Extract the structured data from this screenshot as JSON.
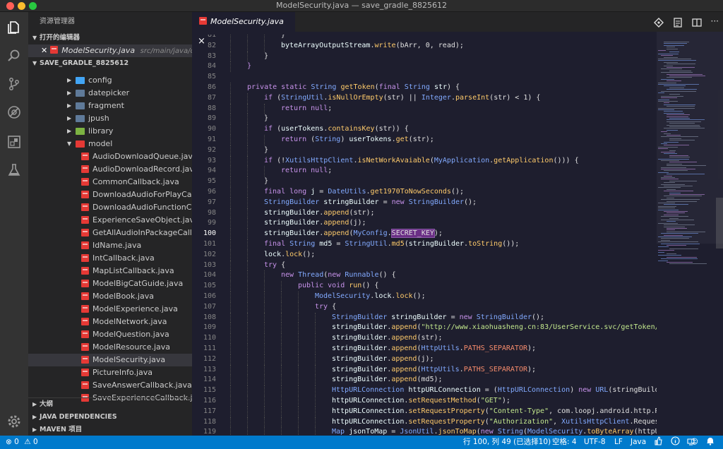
{
  "window": {
    "title": "ModelSecurity.java — save_gradle_8825612",
    "traffic": {
      "close": "#ff5f57",
      "minimize": "#febc2e",
      "zoom": "#28c840"
    }
  },
  "activity_bar": [
    "files-icon",
    "search-icon",
    "source-control-icon",
    "debug-icon",
    "extensions-icon",
    "test-icon",
    "settings-gear-icon"
  ],
  "sidebar": {
    "header": "资源管理器",
    "open_editors": {
      "title": "打开的编辑器",
      "items": [
        {
          "name": "ModelSecurity.java",
          "path": "src/main/java/co..."
        }
      ]
    },
    "project": {
      "title": "SAVE_GRADLE_8825612",
      "folders": [
        {
          "label": "config",
          "color": "#42a5f5"
        },
        {
          "label": "datepicker",
          "color": "#5f7a99"
        },
        {
          "label": "fragment",
          "color": "#5f7a99"
        },
        {
          "label": "jpush",
          "color": "#5f7a99"
        },
        {
          "label": "library",
          "color": "#7cb342"
        },
        {
          "label": "model",
          "color": "#e53935"
        }
      ],
      "files": [
        "AudioDownloadQueue.java",
        "AudioDownloadRecord.java",
        "CommonCallback.java",
        "DownloadAudioForPlayCal...",
        "DownloadAudioFunctionC...",
        "ExperienceSaveObject.java",
        "GetAllAudioInPackageCall...",
        "IdName.java",
        "IntCallback.java",
        "MapListCallback.java",
        "ModelBigCatGuide.java",
        "ModelBook.java",
        "ModelExperience.java",
        "ModelNetwork.java",
        "ModelQuestion.java",
        "ModelResource.java",
        "ModelSecurity.java",
        "PictureInfo.java",
        "SaveAnswerCallback.java",
        "SaveExperienceCallback.j..."
      ],
      "selected_file": "ModelSecurity.java"
    },
    "bottom_sections": [
      "大纲",
      "JAVA DEPENDENCIES",
      "MAVEN 项目"
    ]
  },
  "editor": {
    "tab": {
      "label": "ModelSecurity.java",
      "close": "×"
    },
    "current_line": 100,
    "lines": [
      {
        "n": "81",
        "indent": 3,
        "tokens": [
          [
            "}",
            "p"
          ]
        ]
      },
      {
        "n": "82",
        "indent": 3,
        "tokens": [
          [
            "byteArrayOutputStream",
            "v"
          ],
          [
            ".",
            "p"
          ],
          [
            "write",
            "f"
          ],
          [
            "(bArr, 0, read);",
            "p"
          ]
        ]
      },
      {
        "n": "83",
        "indent": 2,
        "tokens": [
          [
            "}",
            "p"
          ]
        ]
      },
      {
        "n": "84",
        "indent": 1,
        "tokens": [
          [
            "}",
            "k"
          ]
        ]
      },
      {
        "n": "85",
        "indent": 0,
        "tokens": []
      },
      {
        "n": "86",
        "indent": 1,
        "tokens": [
          [
            "private static ",
            "k"
          ],
          [
            "String ",
            "t"
          ],
          [
            "getToken",
            "f"
          ],
          [
            "(",
            "p"
          ],
          [
            "final ",
            "k"
          ],
          [
            "String ",
            "t"
          ],
          [
            "str",
            "v"
          ],
          [
            ") {",
            "p"
          ]
        ]
      },
      {
        "n": "87",
        "indent": 2,
        "tokens": [
          [
            "if ",
            "k"
          ],
          [
            "(",
            "p"
          ],
          [
            "StringUtil",
            "t"
          ],
          [
            ".",
            "p"
          ],
          [
            "isNullOrEmpty",
            "f"
          ],
          [
            "(str) || ",
            "p"
          ],
          [
            "Integer",
            "t"
          ],
          [
            ".",
            "p"
          ],
          [
            "parseInt",
            "f"
          ],
          [
            "(str) < 1) {",
            "p"
          ]
        ]
      },
      {
        "n": "88",
        "indent": 3,
        "tokens": [
          [
            "return null",
            "k"
          ],
          [
            ";",
            "p"
          ]
        ]
      },
      {
        "n": "89",
        "indent": 2,
        "tokens": [
          [
            "}",
            "p"
          ]
        ]
      },
      {
        "n": "90",
        "indent": 2,
        "tokens": [
          [
            "if ",
            "k"
          ],
          [
            "(",
            "p"
          ],
          [
            "userTokens",
            "v"
          ],
          [
            ".",
            "p"
          ],
          [
            "containsKey",
            "f"
          ],
          [
            "(str)) {",
            "p"
          ]
        ]
      },
      {
        "n": "91",
        "indent": 3,
        "tokens": [
          [
            "return ",
            "k"
          ],
          [
            "(",
            "p"
          ],
          [
            "String",
            "t"
          ],
          [
            ") ",
            "p"
          ],
          [
            "userTokens",
            "v"
          ],
          [
            ".",
            "p"
          ],
          [
            "get",
            "f"
          ],
          [
            "(str);",
            "p"
          ]
        ]
      },
      {
        "n": "92",
        "indent": 2,
        "tokens": [
          [
            "}",
            "p"
          ]
        ]
      },
      {
        "n": "93",
        "indent": 2,
        "tokens": [
          [
            "if ",
            "k"
          ],
          [
            "(!",
            "p"
          ],
          [
            "XutilsHttpClient",
            "t"
          ],
          [
            ".",
            "p"
          ],
          [
            "isNetWorkAvaiable",
            "f"
          ],
          [
            "(",
            "p"
          ],
          [
            "MyApplication",
            "t"
          ],
          [
            ".",
            "p"
          ],
          [
            "getApplication",
            "f"
          ],
          [
            "())) {",
            "p"
          ]
        ]
      },
      {
        "n": "94",
        "indent": 3,
        "tokens": [
          [
            "return null",
            "k"
          ],
          [
            ";",
            "p"
          ]
        ]
      },
      {
        "n": "95",
        "indent": 2,
        "tokens": [
          [
            "}",
            "p"
          ]
        ]
      },
      {
        "n": "96",
        "indent": 2,
        "tokens": [
          [
            "final long ",
            "k"
          ],
          [
            "j",
            "v"
          ],
          [
            " = ",
            "p"
          ],
          [
            "DateUtils",
            "t"
          ],
          [
            ".",
            "p"
          ],
          [
            "get1970ToNowSeconds",
            "f"
          ],
          [
            "();",
            "p"
          ]
        ]
      },
      {
        "n": "97",
        "indent": 2,
        "tokens": [
          [
            "StringBuilder ",
            "t"
          ],
          [
            "stringBuilder",
            "v"
          ],
          [
            " = ",
            "p"
          ],
          [
            "new ",
            "k"
          ],
          [
            "StringBuilder",
            "t"
          ],
          [
            "();",
            "p"
          ]
        ]
      },
      {
        "n": "98",
        "indent": 2,
        "tokens": [
          [
            "stringBuilder",
            "v"
          ],
          [
            ".",
            "p"
          ],
          [
            "append",
            "f"
          ],
          [
            "(str);",
            "p"
          ]
        ]
      },
      {
        "n": "99",
        "indent": 2,
        "tokens": [
          [
            "stringBuilder",
            "v"
          ],
          [
            ".",
            "p"
          ],
          [
            "append",
            "f"
          ],
          [
            "(j);",
            "p"
          ]
        ]
      },
      {
        "n": "100",
        "indent": 2,
        "tokens": [
          [
            "stringBuilder",
            "v"
          ],
          [
            ".",
            "p"
          ],
          [
            "append",
            "f"
          ],
          [
            "(",
            "p"
          ],
          [
            "MyConfig",
            "t"
          ],
          [
            ".",
            "p"
          ],
          [
            "SECRET_KEY",
            "hl"
          ],
          [
            ");",
            "p"
          ]
        ]
      },
      {
        "n": "101",
        "indent": 2,
        "tokens": [
          [
            "final ",
            "k"
          ],
          [
            "String ",
            "t"
          ],
          [
            "md5",
            "v"
          ],
          [
            " = ",
            "p"
          ],
          [
            "StringUtil",
            "t"
          ],
          [
            ".",
            "p"
          ],
          [
            "md5",
            "f"
          ],
          [
            "(",
            "p"
          ],
          [
            "stringBuilder",
            "v"
          ],
          [
            ".",
            "p"
          ],
          [
            "toString",
            "f"
          ],
          [
            "());",
            "p"
          ]
        ]
      },
      {
        "n": "102",
        "indent": 2,
        "tokens": [
          [
            "lock",
            "v"
          ],
          [
            ".",
            "p"
          ],
          [
            "lock",
            "f"
          ],
          [
            "();",
            "p"
          ]
        ]
      },
      {
        "n": "103",
        "indent": 2,
        "tokens": [
          [
            "try ",
            "k"
          ],
          [
            "{",
            "p"
          ]
        ]
      },
      {
        "n": "104",
        "indent": 3,
        "tokens": [
          [
            "new ",
            "k"
          ],
          [
            "Thread",
            "t"
          ],
          [
            "(",
            "p"
          ],
          [
            "new ",
            "k"
          ],
          [
            "Runnable",
            "t"
          ],
          [
            "() {",
            "p"
          ]
        ]
      },
      {
        "n": "105",
        "indent": 4,
        "tokens": [
          [
            "public void ",
            "k"
          ],
          [
            "run",
            "f"
          ],
          [
            "() {",
            "p"
          ]
        ]
      },
      {
        "n": "106",
        "indent": 5,
        "tokens": [
          [
            "ModelSecurity",
            "t"
          ],
          [
            ".",
            "p"
          ],
          [
            "lock",
            "v"
          ],
          [
            ".",
            "p"
          ],
          [
            "lock",
            "f"
          ],
          [
            "();",
            "p"
          ]
        ]
      },
      {
        "n": "107",
        "indent": 5,
        "tokens": [
          [
            "try ",
            "k"
          ],
          [
            "{",
            "p"
          ]
        ]
      },
      {
        "n": "108",
        "indent": 6,
        "tokens": [
          [
            "StringBuilder ",
            "t"
          ],
          [
            "stringBuilder",
            "v"
          ],
          [
            " = ",
            "p"
          ],
          [
            "new ",
            "k"
          ],
          [
            "StringBuilder",
            "t"
          ],
          [
            "();",
            "p"
          ]
        ]
      },
      {
        "n": "109",
        "indent": 6,
        "tokens": [
          [
            "stringBuilder",
            "v"
          ],
          [
            ".",
            "p"
          ],
          [
            "append",
            "f"
          ],
          [
            "(",
            "p"
          ],
          [
            "\"http://www.xiaohuasheng.cn:83/UserService.svc/getToken/\"",
            "s"
          ]
        ]
      },
      {
        "n": "110",
        "indent": 6,
        "tokens": [
          [
            "stringBuilder",
            "v"
          ],
          [
            ".",
            "p"
          ],
          [
            "append",
            "f"
          ],
          [
            "(str);",
            "p"
          ]
        ]
      },
      {
        "n": "111",
        "indent": 6,
        "tokens": [
          [
            "stringBuilder",
            "v"
          ],
          [
            ".",
            "p"
          ],
          [
            "append",
            "f"
          ],
          [
            "(",
            "p"
          ],
          [
            "HttpUtils",
            "t"
          ],
          [
            ".",
            "p"
          ],
          [
            "PATHS_SEPARATOR",
            "c"
          ],
          [
            ");",
            "p"
          ]
        ]
      },
      {
        "n": "112",
        "indent": 6,
        "tokens": [
          [
            "stringBuilder",
            "v"
          ],
          [
            ".",
            "p"
          ],
          [
            "append",
            "f"
          ],
          [
            "(j);",
            "p"
          ]
        ]
      },
      {
        "n": "113",
        "indent": 6,
        "tokens": [
          [
            "stringBuilder",
            "v"
          ],
          [
            ".",
            "p"
          ],
          [
            "append",
            "f"
          ],
          [
            "(",
            "p"
          ],
          [
            "HttpUtils",
            "t"
          ],
          [
            ".",
            "p"
          ],
          [
            "PATHS_SEPARATOR",
            "c"
          ],
          [
            ");",
            "p"
          ]
        ]
      },
      {
        "n": "114",
        "indent": 6,
        "tokens": [
          [
            "stringBuilder",
            "v"
          ],
          [
            ".",
            "p"
          ],
          [
            "append",
            "f"
          ],
          [
            "(md5);",
            "p"
          ]
        ]
      },
      {
        "n": "115",
        "indent": 6,
        "tokens": [
          [
            "HttpURLConnection ",
            "t"
          ],
          [
            "httpURLConnection",
            "v"
          ],
          [
            " = (",
            "p"
          ],
          [
            "HttpURLConnection",
            "t"
          ],
          [
            ") ",
            "p"
          ],
          [
            "new ",
            "k"
          ],
          [
            "URL",
            "t"
          ],
          [
            "(stringBuilde",
            "p"
          ]
        ]
      },
      {
        "n": "116",
        "indent": 6,
        "tokens": [
          [
            "httpURLConnection",
            "v"
          ],
          [
            ".",
            "p"
          ],
          [
            "setRequestMethod",
            "f"
          ],
          [
            "(",
            "p"
          ],
          [
            "\"GET\"",
            "s"
          ],
          [
            ");",
            "p"
          ]
        ]
      },
      {
        "n": "117",
        "indent": 6,
        "tokens": [
          [
            "httpURLConnection",
            "v"
          ],
          [
            ".",
            "p"
          ],
          [
            "setRequestProperty",
            "f"
          ],
          [
            "(",
            "p"
          ],
          [
            "\"Content-Type\"",
            "s"
          ],
          [
            ", com.loopj.android.http.Re",
            "p"
          ]
        ]
      },
      {
        "n": "118",
        "indent": 6,
        "tokens": [
          [
            "httpURLConnection",
            "v"
          ],
          [
            ".",
            "p"
          ],
          [
            "setRequestProperty",
            "f"
          ],
          [
            "(",
            "p"
          ],
          [
            "\"Authorization\"",
            "s"
          ],
          [
            ", ",
            "p"
          ],
          [
            "XutilsHttpClient",
            "t"
          ],
          [
            ".",
            "p"
          ],
          [
            "Request",
            "p"
          ]
        ]
      },
      {
        "n": "119",
        "indent": 6,
        "tokens": [
          [
            "Map ",
            "t"
          ],
          [
            "jsonToMap",
            "v"
          ],
          [
            " = ",
            "p"
          ],
          [
            "JsonUtil",
            "t"
          ],
          [
            ".",
            "p"
          ],
          [
            "jsonToMap",
            "f"
          ],
          [
            "(",
            "p"
          ],
          [
            "new ",
            "k"
          ],
          [
            "String",
            "t"
          ],
          [
            "(",
            "p"
          ],
          [
            "ModelSecurity",
            "t"
          ],
          [
            ".",
            "p"
          ],
          [
            "toByteArray",
            "f"
          ],
          [
            "(httpUR",
            "p"
          ]
        ]
      }
    ]
  },
  "token_colors": {
    "k": "#c792ea",
    "t": "#82aaff",
    "f": "#ffcb6b",
    "v": "#eeffff",
    "p": "#e0e0e0",
    "s": "#c3e88d",
    "c": "#f78c6c",
    "hl": "#e0e0e0"
  },
  "statusbar": {
    "errors": "0",
    "warnings": "0",
    "position": "行 100, 列 49 (已选择10)",
    "indent": "空格: 4",
    "encoding": "UTF-8",
    "eol": "LF",
    "language": "Java",
    "color": "#007acc"
  }
}
